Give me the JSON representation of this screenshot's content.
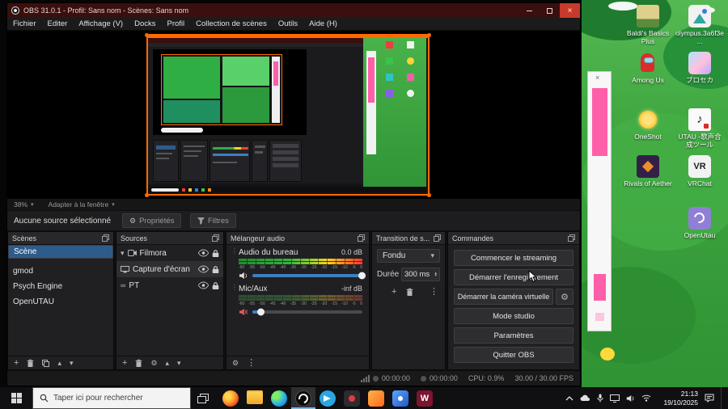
{
  "glyphs": {
    "close": "×",
    "caret_down": "▾",
    "caret_up": "▴",
    "plus": "+",
    "gear": "⚙",
    "dots": "⋮",
    "infinity": "∞"
  },
  "obs": {
    "title": "OBS 31.0.1 - Profil: Sans nom - Scènes: Sans nom",
    "menu": [
      "Fichier",
      "Editer",
      "Affichage (V)",
      "Docks",
      "Profil",
      "Collection de scènes",
      "Outils",
      "Aide (H)"
    ],
    "zoom_level": "38%",
    "zoom_fit": "Adapter à la fenêtre",
    "no_source": "Aucune source sélectionné",
    "properties_label": "Propriétés",
    "filters_label": "Filtres",
    "scenes": {
      "title": "Scènes",
      "items": [
        "Scène",
        "gmod",
        "Psych Engine",
        "OpenUTAU"
      ]
    },
    "sources": {
      "title": "Sources",
      "items": [
        "Filmora",
        "Capture d'écran",
        "PT"
      ]
    },
    "mixer": {
      "title": "Mélangeur audio",
      "ch1_name": "Audio du bureau",
      "ch1_level": "0.0 dB",
      "ch2_name": "Mic/Aux",
      "ch2_level": "-inf dB",
      "scale": [
        "-60",
        "-55",
        "-50",
        "-45",
        "-40",
        "-35",
        "-30",
        "-25",
        "-20",
        "-15",
        "-10",
        "-5",
        "0"
      ]
    },
    "transition": {
      "title": "Transition de s...",
      "selected": "Fondu",
      "duration_label": "Durée",
      "duration_value": "300 ms"
    },
    "controls": {
      "title": "Commandes",
      "buttons": [
        "Commencer le streaming",
        "Démarrer l'enregistrement",
        "Démarrer la caméra virtuelle",
        "Mode studio",
        "Paramètres",
        "Quitter OBS"
      ]
    },
    "status": {
      "rec": "00:00:00",
      "stream": "00:00:00",
      "cpu": "CPU: 0.9%",
      "fps": "30.00 / 30.00 FPS"
    }
  },
  "desktop_icons": [
    {
      "label": "Baldi's Basics Plus"
    },
    {
      "label": "olympus.3a6f3e..."
    },
    {
      "label": "Among Us"
    },
    {
      "label": "プロセカ"
    },
    {
      "label": "OneShot"
    },
    {
      "label": "UTAU -歌声合成ツール",
      "icon_text": "♪"
    },
    {
      "label": "Rivals of Aether"
    },
    {
      "label": "VRChat",
      "icon_text": "VR"
    },
    {
      "label": "OpenUtau"
    }
  ],
  "taskbar": {
    "search_placeholder": "Taper ici pour rechercher",
    "time": "21:13",
    "date": "19/10/2025",
    "filmora_letter": "W"
  }
}
